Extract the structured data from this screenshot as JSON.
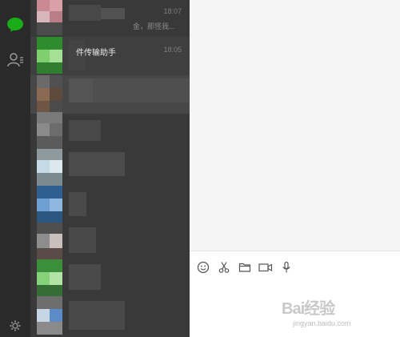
{
  "nav": {
    "items": [
      {
        "icon": "chat-bubble-icon",
        "active": true
      },
      {
        "icon": "contacts-icon",
        "active": false
      },
      {
        "icon": "gear-icon",
        "active": false
      }
    ],
    "accent": "#1aad19"
  },
  "conversations": {
    "first": {
      "time": "18:07",
      "snippet": "金，那怪我..."
    },
    "file_transfer": {
      "name": "件传输助手",
      "time": "18:05"
    }
  },
  "compose": {
    "toolbar": [
      {
        "icon": "emoji-icon"
      },
      {
        "icon": "scissors-icon"
      },
      {
        "icon": "folder-icon"
      },
      {
        "icon": "video-call-icon"
      },
      {
        "icon": "microphone-icon"
      }
    ]
  },
  "watermark": {
    "text": "Bai经验",
    "url": "jingyan.baidu.com"
  }
}
